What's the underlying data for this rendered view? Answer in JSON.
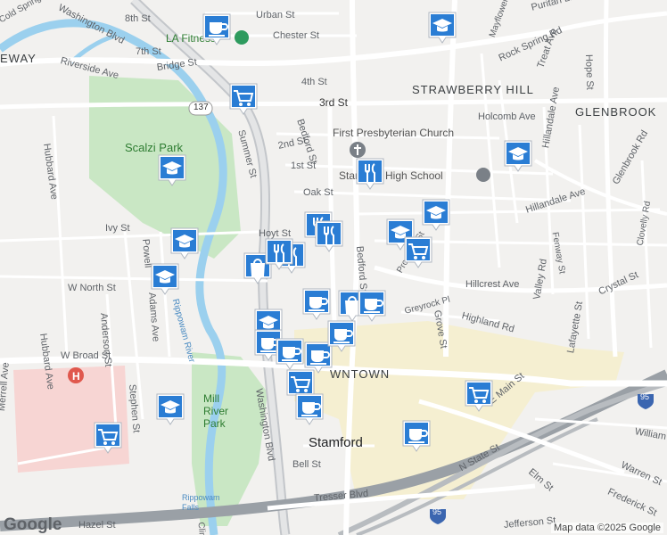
{
  "map": {
    "credit": "Map data ©2025 Google",
    "logo_text": "Google",
    "colors": {
      "land": "#f2f1ef",
      "park": "#c9e7c4",
      "water": "#9bd0ee",
      "highway": "#9aa0a6",
      "major_road": "#ffffff",
      "downtown": "#f5efd1",
      "hospital": "#f7d5d3",
      "pin_fill": "#2a7dd4",
      "pin_bg": "#ffffff"
    }
  },
  "labels": {
    "area_away": "EWAY",
    "area_strawberry_hill": "STRAWBERRY HILL",
    "area_glenbrook": "GLENBROOK",
    "area_downtown": "WNTOWN",
    "city": "Stamford",
    "park_scalzi": "Scalzi Park",
    "park_mill_river": "Mill River Park",
    "water_rippowam": "Rippowam River",
    "water_falls": "Rippowam Falls",
    "poi_church": "First Presbyterian Church",
    "poi_school": "Stamford High School",
    "poi_la_fitness": "LA Fitness",
    "streets": {
      "washington_blvd_n": "Washington Blvd",
      "washington_blvd_s": "Washington Blvd",
      "cold_spring": "Cold Spring Rd",
      "riverside": "Riverside Ave",
      "hubbard": "Hubbard Ave",
      "w_north": "W North St",
      "w_broad": "W Broad St",
      "anderson": "Anderson St",
      "powell": "Powell",
      "adams": "Adams Ave",
      "stephen": "Stephen St",
      "merrell": "Merrell Ave",
      "ivy": "Ivy St",
      "hoyt": "Hoyt St",
      "bridge": "Bridge St",
      "chester": "Chester St",
      "urban": "Urban St",
      "eighth": "8th St",
      "seventh": "7th St",
      "fourth": "4th St",
      "third": "3rd St",
      "second": "2nd St",
      "first": "1st St",
      "oak": "Oak St",
      "bedford_n": "Bedford St",
      "bedford_s": "Bedford St",
      "summer": "Summer St",
      "hope": "Hope St",
      "rock_spring": "Rock Spring Rd",
      "mayflower": "Mayflower Ave",
      "treat": "Treat Ave",
      "puritan": "Puritan Ln",
      "holcomb": "Holcomb Ave",
      "hillandale_ave": "Hillandale Ave",
      "hillandale_ave2": "Hillandale Ave",
      "glenbrook_rd": "Glenbrook Rd",
      "clovelly": "Clovelly Rd",
      "hillcrest": "Hillcrest Ave",
      "highland": "Highland Rd",
      "crystal": "Crystal St",
      "valley": "Valley Rd",
      "fenway": "Fenway St",
      "lafayette": "Lafayette St",
      "grove": "Grove St",
      "greyrock": "Greyrock Pl",
      "prospect": "Prospect St",
      "e_main": "E Main St",
      "n_state": "N State St",
      "elm": "Elm St",
      "tresser": "Tresser Blvd",
      "bell": "Bell St",
      "hazel": "Hazel St",
      "jefferson": "Jefferson St",
      "warren": "Warren St",
      "frederick": "Frederick St",
      "william": "William",
      "clinton": "Clinton",
      "route_137": "137",
      "i95_a": "95",
      "i95_b": "95"
    }
  },
  "pins": [
    {
      "id": "pin-coffee-1",
      "icon": "coffee-cup-icon"
    },
    {
      "id": "pin-school-1",
      "icon": "graduation-cap-icon"
    },
    {
      "id": "pin-cart-1",
      "icon": "shopping-cart-icon"
    },
    {
      "id": "pin-school-2",
      "icon": "graduation-cap-icon"
    },
    {
      "id": "pin-restaurant-1",
      "icon": "fork-knife-icon"
    },
    {
      "id": "pin-school-3",
      "icon": "graduation-cap-icon"
    },
    {
      "id": "pin-school-4",
      "icon": "graduation-cap-icon"
    },
    {
      "id": "pin-school-5",
      "icon": "graduation-cap-icon"
    },
    {
      "id": "pin-restaurant-2",
      "icon": "fork-knife-icon"
    },
    {
      "id": "pin-restaurant-3",
      "icon": "fork-knife-icon"
    },
    {
      "id": "pin-school-6",
      "icon": "graduation-cap-icon"
    },
    {
      "id": "pin-school-7",
      "icon": "graduation-cap-icon"
    },
    {
      "id": "pin-cart-2",
      "icon": "shopping-cart-icon"
    },
    {
      "id": "pin-bag-1",
      "icon": "shopping-bag-icon"
    },
    {
      "id": "pin-restaurant-4",
      "icon": "fork-knife-icon"
    },
    {
      "id": "pin-cluster-1",
      "icon": "fork-knife-icon"
    },
    {
      "id": "pin-coffee-2",
      "icon": "coffee-cup-icon"
    },
    {
      "id": "pin-bag-2",
      "icon": "shopping-bag-icon"
    },
    {
      "id": "pin-coffee-3",
      "icon": "coffee-cup-icon"
    },
    {
      "id": "pin-school-8",
      "icon": "graduation-cap-icon"
    },
    {
      "id": "pin-coffee-4",
      "icon": "coffee-cup-icon"
    },
    {
      "id": "pin-coffee-5",
      "icon": "coffee-cup-icon"
    },
    {
      "id": "pin-coffee-6",
      "icon": "coffee-cup-icon"
    },
    {
      "id": "pin-coffee-7",
      "icon": "coffee-cup-icon"
    },
    {
      "id": "pin-cart-3",
      "icon": "shopping-cart-icon"
    },
    {
      "id": "pin-cart-4",
      "icon": "shopping-cart-icon"
    },
    {
      "id": "pin-coffee-8",
      "icon": "coffee-cup-icon"
    },
    {
      "id": "pin-school-9",
      "icon": "graduation-cap-icon"
    },
    {
      "id": "pin-cart-5",
      "icon": "shopping-cart-icon"
    },
    {
      "id": "pin-coffee-9",
      "icon": "coffee-cup-icon"
    }
  ]
}
